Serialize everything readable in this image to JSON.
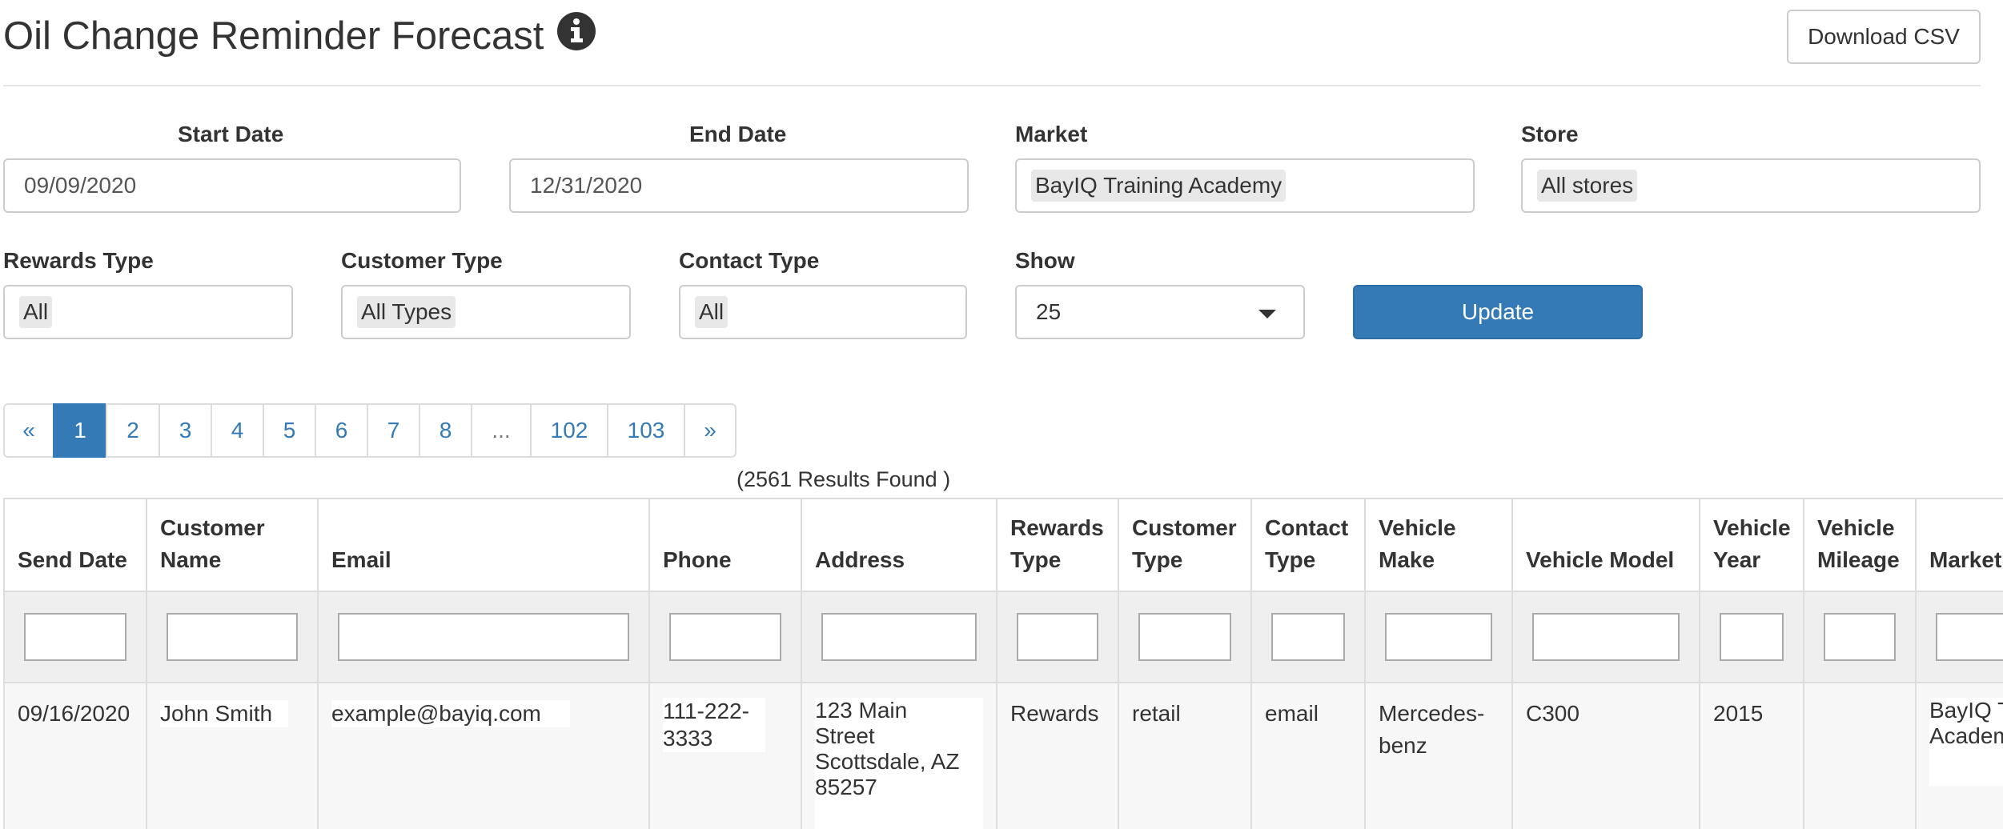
{
  "header": {
    "title": "Oil Change Reminder Forecast",
    "info_icon": "info-circle-icon",
    "download_label": "Download CSV"
  },
  "filters": {
    "start_date": {
      "label": "Start Date",
      "value": "09/09/2020"
    },
    "end_date": {
      "label": "End Date",
      "value": "12/31/2020"
    },
    "market": {
      "label": "Market",
      "value": "BayIQ Training Academy"
    },
    "store": {
      "label": "Store",
      "value": "All stores"
    },
    "rewards_type": {
      "label": "Rewards Type",
      "value": "All"
    },
    "customer_type": {
      "label": "Customer Type",
      "value": "All Types"
    },
    "contact_type": {
      "label": "Contact Type",
      "value": "All"
    },
    "show": {
      "label": "Show",
      "value": "25",
      "caret_icon": "caret-down-icon"
    },
    "update_label": "Update"
  },
  "pagination": {
    "prev": "«",
    "pages": [
      "1",
      "2",
      "3",
      "4",
      "5",
      "6",
      "7",
      "8"
    ],
    "ellipsis": "...",
    "tail": [
      "102",
      "103"
    ],
    "next": "»",
    "active": "1"
  },
  "results_text": "(2561 Results Found )",
  "table": {
    "columns": [
      [
        "Send Date"
      ],
      [
        "Customer",
        "Name"
      ],
      [
        "Email"
      ],
      [
        "Phone"
      ],
      [
        "Address"
      ],
      [
        "Rewards",
        "Type"
      ],
      [
        "Customer",
        "Type"
      ],
      [
        "Contact",
        "Type"
      ],
      [
        "Vehicle",
        "Make"
      ],
      [
        "Vehicle Model"
      ],
      [
        "Vehicle",
        "Year"
      ],
      [
        "Vehicle",
        "Mileage"
      ],
      [
        "Market"
      ]
    ],
    "rows": [
      {
        "send_date": "09/16/2020",
        "customer_name": "John Smith",
        "email": "example@bayiq.com",
        "phone": [
          "111-222-",
          "3333"
        ],
        "address": [
          "123 Main Street",
          "Scottsdale, AZ",
          "85257"
        ],
        "rewards_type": "Rewards",
        "customer_type": "retail",
        "contact_type": "email",
        "vehicle_make": [
          "Mercedes-",
          "benz"
        ],
        "vehicle_model": "C300",
        "vehicle_year": "2015",
        "vehicle_mileage": "",
        "market": [
          "BayIQ T",
          "Academ"
        ]
      }
    ]
  }
}
